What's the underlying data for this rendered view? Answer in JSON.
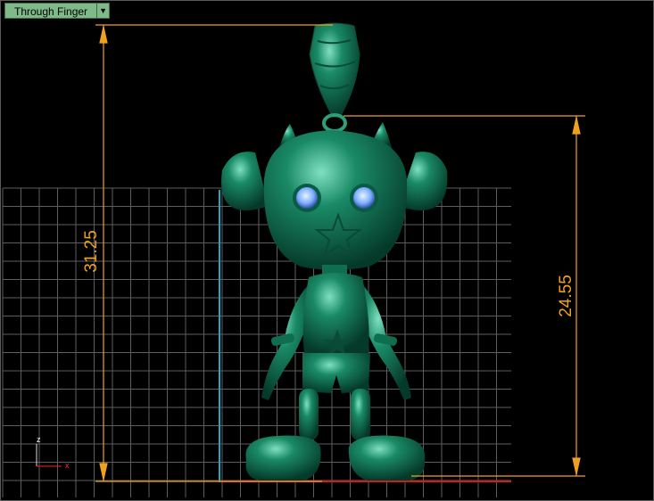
{
  "viewport": {
    "title": "Through Finger",
    "dropdown_icon": "chevron-down-icon"
  },
  "dimensions": {
    "left_height": "31.25",
    "right_height": "24.55"
  },
  "axes": {
    "x_label": "x",
    "z_label": "z"
  },
  "colors": {
    "background": "#000000",
    "grid_line": "#6a6a6a",
    "dimension": "#f0a020",
    "model": "#0f7a5a",
    "gem": "#7db0ff",
    "x_axis": "#ff2020",
    "y_axis": "#1ea8c8"
  },
  "model": {
    "type": "pendant figure",
    "features": [
      "bail-loop",
      "horns",
      "ears",
      "gem-eyes",
      "star"
    ]
  }
}
